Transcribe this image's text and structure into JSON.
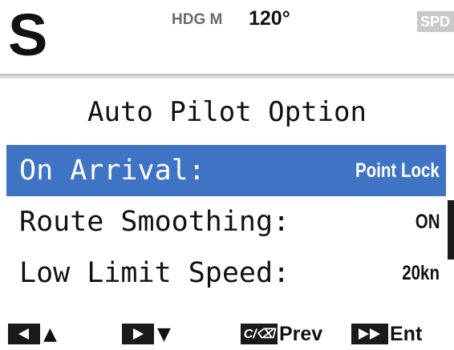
{
  "header": {
    "mode": "S",
    "heading_label": "HDG M",
    "heading_value": "120°",
    "speed_tag": "SPD"
  },
  "title": "Auto Pilot Option",
  "menu": {
    "items": [
      {
        "label": "On Arrival:",
        "value": "Point Lock",
        "selected": true
      },
      {
        "label": "Route Smoothing:",
        "value": "ON",
        "selected": false
      },
      {
        "label": "Low Limit Speed:",
        "value": "20kn",
        "selected": false
      }
    ]
  },
  "footer": {
    "up": {
      "icon": "left-arrow-key-icon",
      "glyph": "▲"
    },
    "down": {
      "icon": "right-arrow-key-icon",
      "glyph": "▼"
    },
    "prev": {
      "icon": "cancel-key-icon",
      "key_text": "C/⌫",
      "label": "Prev"
    },
    "enter": {
      "icon": "fast-forward-key-icon",
      "label": "Ent"
    }
  },
  "colors": {
    "selection": "#3f73c4",
    "key_fill": "#1a1a1a",
    "speed_tag_bg": "#c9c9c9"
  }
}
